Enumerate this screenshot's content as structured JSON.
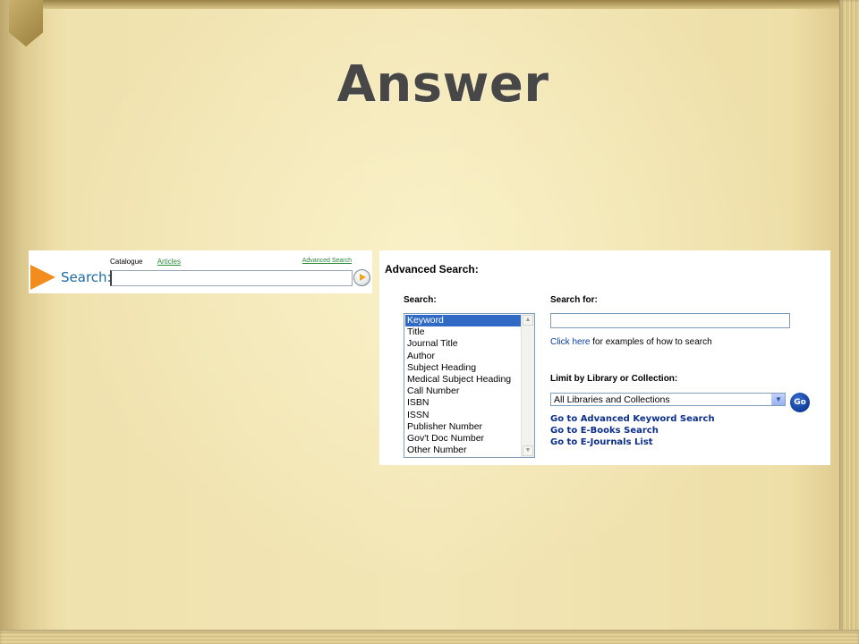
{
  "slide": {
    "title": "Answer"
  },
  "quick_search": {
    "tab_catalogue": "Catalogue",
    "tab_articles": "Articles",
    "advanced_link": "Advanced Search",
    "search_label": "Search:",
    "search_value": ""
  },
  "advanced_search": {
    "heading": "Advanced Search:",
    "search_label": "Search:",
    "search_types": [
      "Keyword",
      "Title",
      "Journal Title",
      "Author",
      "Subject Heading",
      "Medical Subject Heading",
      "Call Number",
      "ISBN",
      "ISSN",
      "Publisher Number",
      "Gov't Doc Number",
      "Other Number"
    ],
    "selected_type": "Keyword",
    "search_for_label": "Search for:",
    "search_for_value": "",
    "click_here": "Click here",
    "examples_text": " for examples of how to search",
    "limit_label": "Limit by Library or Collection:",
    "library_selected": "All Libraries and Collections",
    "go_label": "Go",
    "links": [
      "Go to Advanced Keyword Search",
      "Go to E-Books Search",
      "Go to E-Journals List"
    ]
  },
  "colors": {
    "accent_orange": "#f28c1d",
    "link_blue": "#0b3ea8",
    "selection_blue": "#316ac5",
    "title_gray": "#474747"
  }
}
